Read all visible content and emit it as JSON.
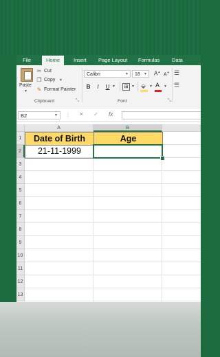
{
  "ribbon_tabs": [
    "File",
    "Home",
    "Insert",
    "Page Layout",
    "Formulas",
    "Data"
  ],
  "clipboard": {
    "paste_label": "Paste",
    "cut_label": "Cut",
    "copy_label": "Copy",
    "format_painter_label": "Format Painter",
    "group_label": "Clipboard"
  },
  "font": {
    "font_name": "Calibri",
    "font_size": "18",
    "group_label": "Font",
    "bold": "B",
    "italic": "I",
    "underline": "U",
    "font_color_glyph": "A"
  },
  "formula_bar": {
    "name_box": "B2",
    "cancel": "✕",
    "enter": "✓",
    "fx": "fx",
    "formula": ""
  },
  "sheet": {
    "columns": [
      "A",
      "B"
    ],
    "rows": [
      "1",
      "2",
      "3",
      "4",
      "5",
      "6",
      "7",
      "8",
      "9",
      "10",
      "11",
      "12",
      "13"
    ],
    "cells": {
      "A1": "Date of Birth",
      "B1": "Age",
      "A2": "21-11-1999",
      "B2": ""
    },
    "header_fill": "#ffd966",
    "selection_color": "#217346"
  },
  "colors": {
    "excel_green": "#217346",
    "background_green": "#1b6b3f"
  }
}
